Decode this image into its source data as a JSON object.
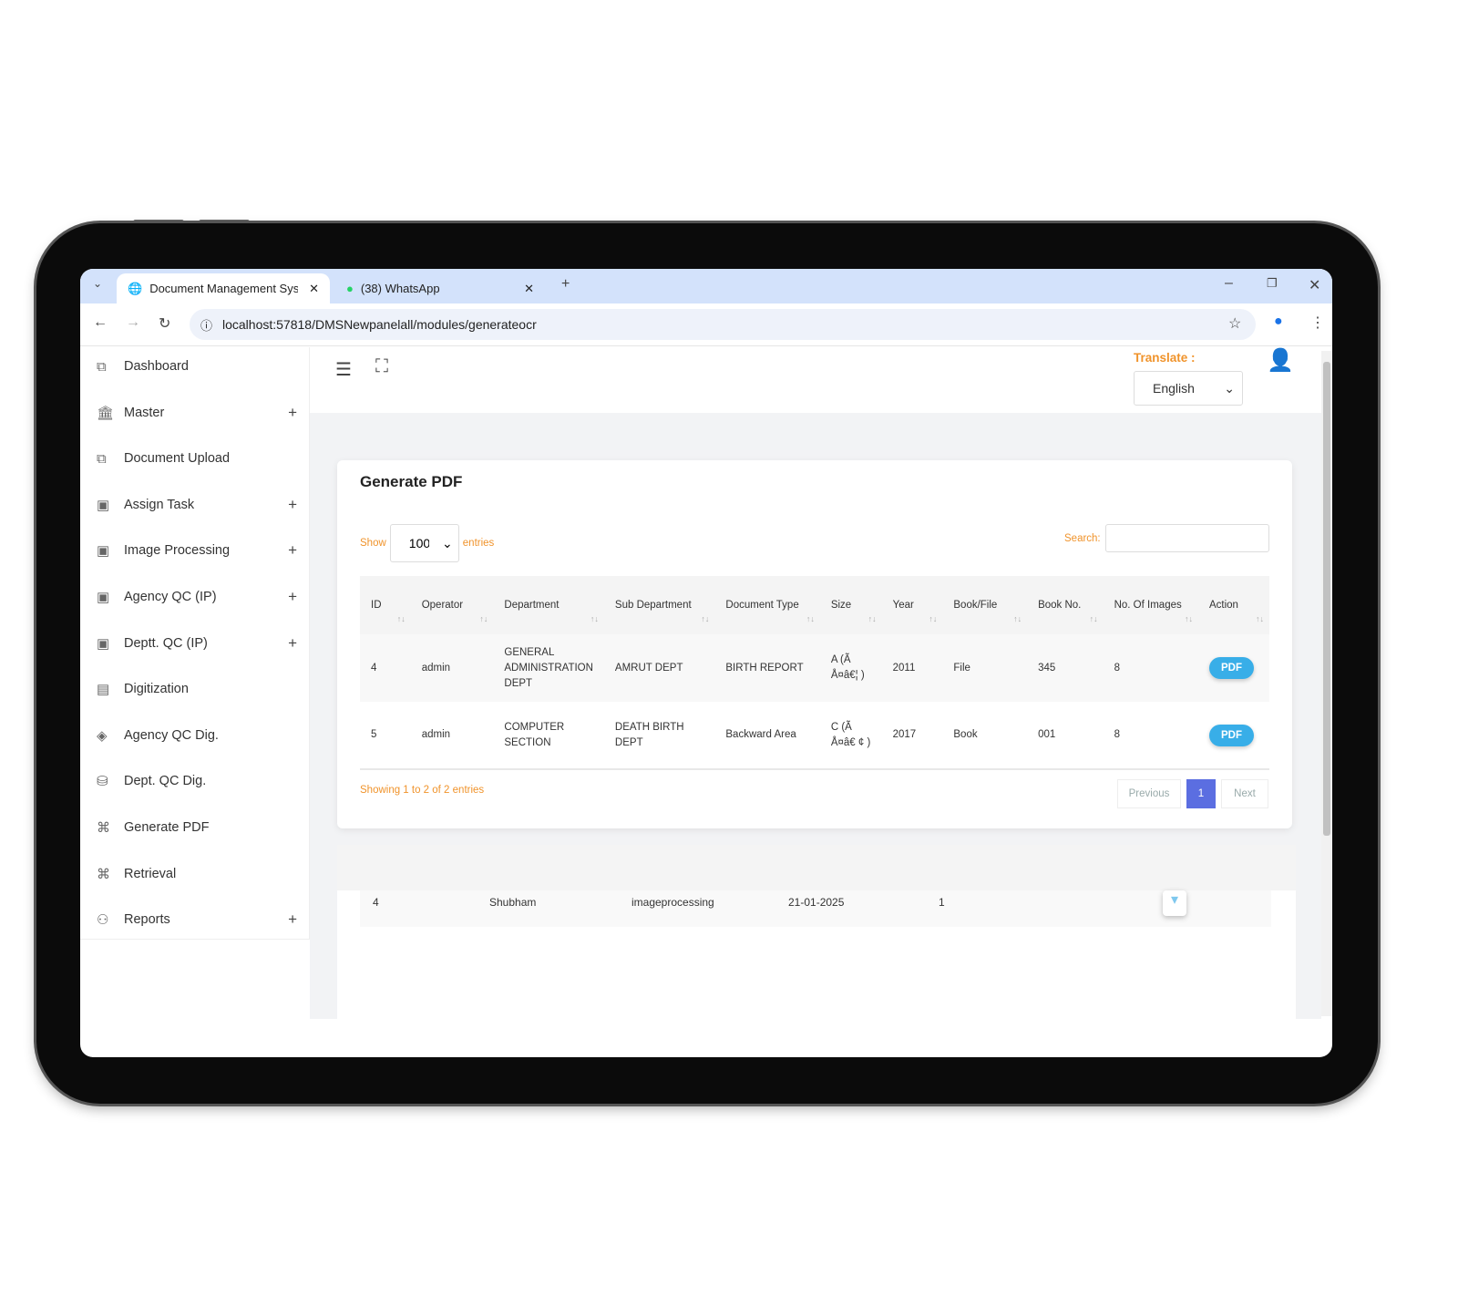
{
  "browser": {
    "tabs": [
      {
        "title": "Document Management System",
        "icon": "globe-icon",
        "active": true
      },
      {
        "title": "(38) WhatsApp",
        "icon": "whatsapp-icon",
        "active": false
      }
    ],
    "url": "localhost:57818/DMSNewpanelall/modules/generateocr"
  },
  "sidebar": {
    "items": [
      {
        "label": "Dashboard",
        "icon": "copy-icon",
        "expandable": false
      },
      {
        "label": "Master",
        "icon": "building-icon",
        "expandable": true
      },
      {
        "label": "Document Upload",
        "icon": "copy-icon",
        "expandable": false
      },
      {
        "label": "Assign Task",
        "icon": "calendar-check-icon",
        "expandable": true
      },
      {
        "label": "Image Processing",
        "icon": "calendar-check-icon",
        "expandable": true
      },
      {
        "label": "Agency QC (IP)",
        "icon": "calendar-check-icon",
        "expandable": true
      },
      {
        "label": "Deptt. QC (IP)",
        "icon": "calendar-check-icon",
        "expandable": true
      },
      {
        "label": "Digitization",
        "icon": "layout-icon",
        "expandable": false
      },
      {
        "label": "Agency QC Dig.",
        "icon": "layers-icon",
        "expandable": false
      },
      {
        "label": "Dept. QC Dig.",
        "icon": "database-icon",
        "expandable": false
      },
      {
        "label": "Generate PDF",
        "icon": "command-icon",
        "expandable": false
      },
      {
        "label": "Retrieval",
        "icon": "command-icon",
        "expandable": false
      },
      {
        "label": "Reports",
        "icon": "user-icon",
        "expandable": true
      }
    ]
  },
  "header": {
    "translate_label": "Translate :",
    "language": "English"
  },
  "card": {
    "title": "Generate PDF",
    "show_label": "Show",
    "entries_value": "100",
    "entries_label": "entries",
    "search_label": "Search:",
    "search_value": "",
    "columns": [
      "ID",
      "Operator",
      "Department",
      "Sub Department",
      "Document Type",
      "Size",
      "Year",
      "Book/File",
      "Book No.",
      "No. Of Images",
      "Action"
    ],
    "rows": [
      [
        "4",
        "admin",
        "GENERAL ADMINISTRATION DEPT",
        "AMRUT DEPT",
        "BIRTH REPORT",
        "A (Ã Å¤â€¦ )",
        "2011",
        "File",
        "345",
        "8",
        "PDF"
      ],
      [
        "5",
        "admin",
        "COMPUTER SECTION",
        "DEATH BIRTH DEPT",
        "Backward Area",
        "C (Ã Å¤â€ ¢ )",
        "2017",
        "Book",
        "001",
        "8",
        "PDF"
      ]
    ],
    "info": "Showing 1 to 2 of 2 entries",
    "pagination": {
      "previous": "Previous",
      "current": "1",
      "next": "Next"
    }
  },
  "card2": {
    "row": [
      "4",
      "Shubham",
      "imageprocessing",
      "21-01-2025",
      "1"
    ]
  },
  "colors": {
    "accent_orange": "#f0932b",
    "pdf_button": "#38aee8",
    "page_active": "#5b6ee1"
  }
}
